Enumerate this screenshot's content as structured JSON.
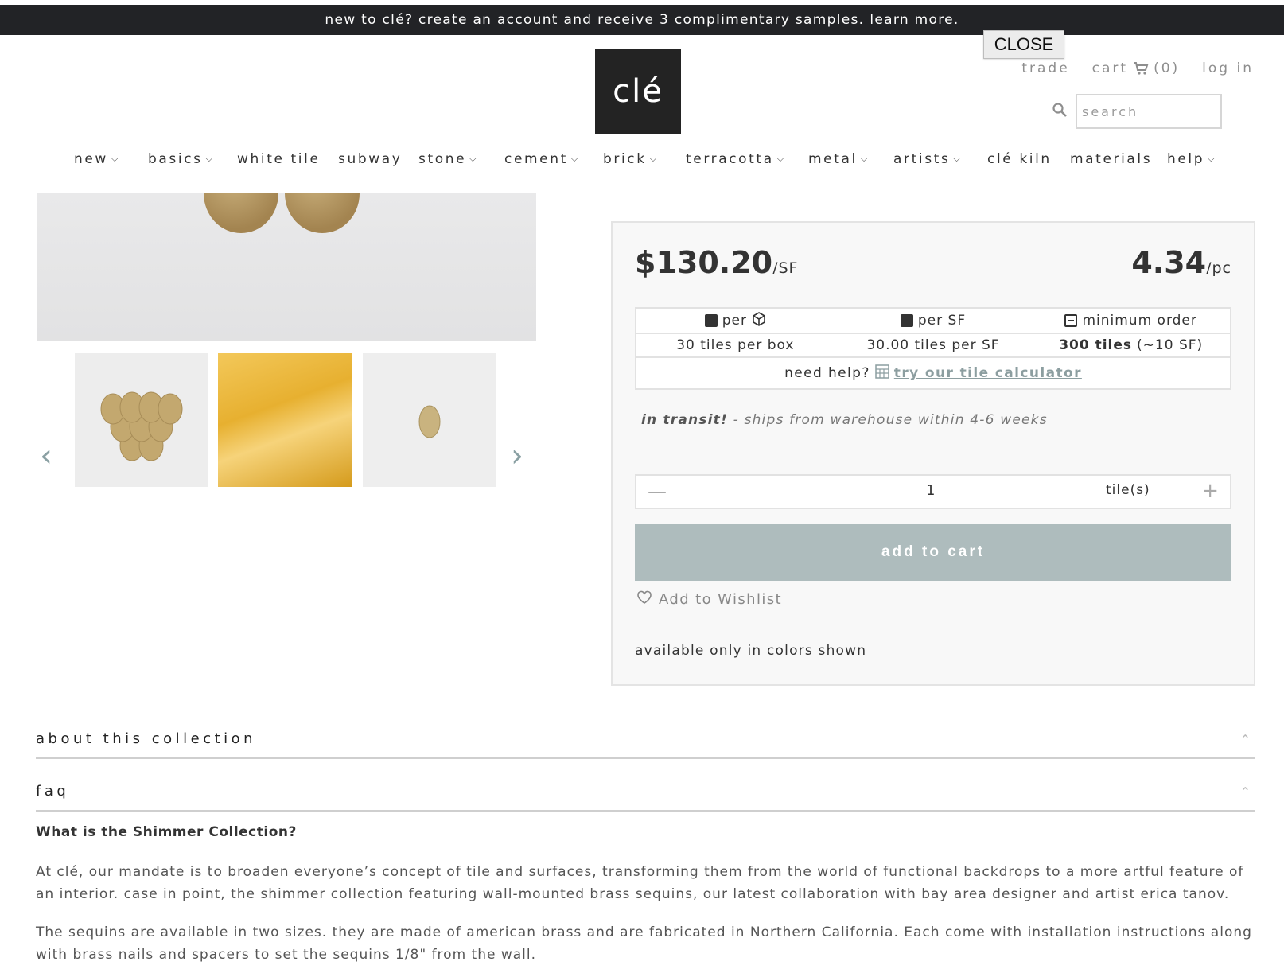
{
  "announcement": {
    "text": "new to clé? create an account and receive 3 complimentary samples.",
    "link": "learn more."
  },
  "close_button": "CLOSE",
  "logo": "clé",
  "account": {
    "trade": "trade",
    "cart": "cart",
    "cart_count": "(0)",
    "login": "log in"
  },
  "search": {
    "placeholder": "search"
  },
  "nav": [
    {
      "label": "new",
      "has_dropdown": true
    },
    {
      "label": "basics",
      "has_dropdown": true
    },
    {
      "label": "white tile",
      "has_dropdown": false
    },
    {
      "label": "subway",
      "has_dropdown": false
    },
    {
      "label": "stone",
      "has_dropdown": true
    },
    {
      "label": "cement",
      "has_dropdown": true
    },
    {
      "label": "brick",
      "has_dropdown": true
    },
    {
      "label": "terracotta",
      "has_dropdown": true
    },
    {
      "label": "metal",
      "has_dropdown": true
    },
    {
      "label": "artists",
      "has_dropdown": true
    },
    {
      "label": "clé kiln",
      "has_dropdown": false
    },
    {
      "label": "materials",
      "has_dropdown": false
    },
    {
      "label": "help",
      "has_dropdown": true
    }
  ],
  "product": {
    "price_sf": "$130.20",
    "price_sf_unit": "/SF",
    "price_pc": "4.34",
    "price_pc_unit": "/pc",
    "spec_headers": [
      "per",
      "per SF",
      "minimum order"
    ],
    "spec_values": [
      "30 tiles per box",
      "30.00 tiles per SF"
    ],
    "min_order_bold": "300 tiles",
    "min_order_rest": "(~10 SF)",
    "help_text": "need help?",
    "help_link": "try our tile calculator",
    "transit_bold": "in transit!",
    "transit_rest": "- ships from warehouse within 4-6 weeks",
    "quantity": "1",
    "quantity_unit": "tile(s)",
    "add_to_cart": "add to cart",
    "wishlist": "Add to Wishlist",
    "availability": "available only in colors shown"
  },
  "accordions": {
    "about": "about this collection",
    "faq": "faq"
  },
  "faq": {
    "question": "What is the Shimmer Collection?",
    "para1": "At clé, our mandate is to broaden everyone’s concept of tile and surfaces, transforming them from the world of functional backdrops to a more artful feature of an interior. case in point, the shimmer collection featuring wall-mounted brass sequins, our latest collaboration with bay area designer and artist erica tanov.",
    "para2": "The sequins are available in two sizes. they are made of american brass and are fabricated in Northern California. Each come with installation instructions along with brass nails and spacers to set the sequins 1/8\" from the wall."
  },
  "icons": {
    "chevron": "chevron-down-icon",
    "cart": "cart-icon",
    "search": "search-icon",
    "box": "box-icon",
    "calculator": "calculator-icon",
    "heart": "heart-icon",
    "prev": "chevron-left-icon",
    "next": "chevron-right-icon"
  },
  "colors": {
    "announce_bg": "#222326",
    "logo_bg": "#232323",
    "button_bg": "#aebcbd",
    "accent_link": "#8c9ea0"
  }
}
